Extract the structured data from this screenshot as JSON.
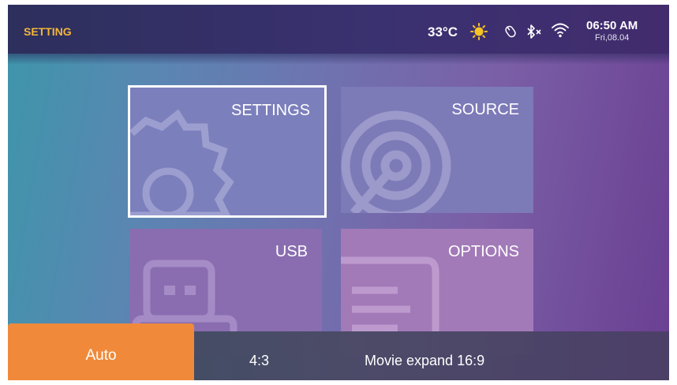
{
  "header": {
    "title": "SETTING",
    "temperature": "33°C",
    "weather_icon": "sun-icon",
    "status_icons": [
      "mouse-icon",
      "bluetooth-off-icon",
      "wifi-icon"
    ],
    "time": "06:50 AM",
    "date": "Fri,08.04"
  },
  "tiles": [
    {
      "label": "SETTINGS",
      "icon": "gear-icon",
      "selected": true
    },
    {
      "label": "SOURCE",
      "icon": "source-icon",
      "selected": false
    },
    {
      "label": "USB",
      "icon": "usb-icon",
      "selected": false
    },
    {
      "label": "OPTIONS",
      "icon": "document-icon",
      "selected": false
    }
  ],
  "aspect_bar": {
    "options": [
      "Auto",
      "4:3",
      "Movie expand 16:9"
    ],
    "selected": "Auto"
  },
  "colors": {
    "accent": "#f08a3a",
    "title": "#f3b53b"
  }
}
